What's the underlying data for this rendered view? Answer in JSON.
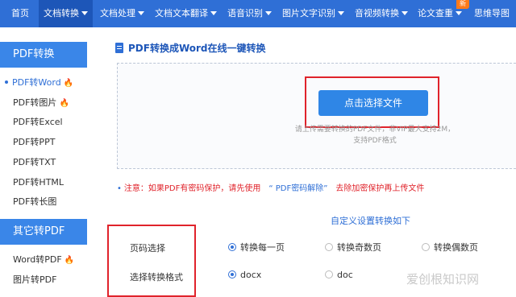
{
  "colors": {
    "nav_bg": "#2f6fd6",
    "accent": "#2f6fd6",
    "highlight_frame": "#e0232b",
    "hot_icon": "#ff6a1a"
  },
  "topnav": {
    "items": [
      {
        "label": "首页",
        "dropdown": false,
        "active": false
      },
      {
        "label": "文档转换",
        "dropdown": true,
        "active": true
      },
      {
        "label": "文档处理",
        "dropdown": true,
        "active": false
      },
      {
        "label": "文档文本翻译",
        "dropdown": true,
        "active": false
      },
      {
        "label": "语音识别",
        "dropdown": true,
        "active": false
      },
      {
        "label": "图片文字识别",
        "dropdown": true,
        "active": false
      },
      {
        "label": "音视频转换",
        "dropdown": true,
        "active": false
      },
      {
        "label": "论文查重",
        "dropdown": true,
        "active": false
      },
      {
        "label": "思维导图",
        "dropdown": false,
        "active": false
      }
    ],
    "new_badge": "新"
  },
  "sidebar": {
    "group1_title": "PDF转换",
    "group1_items": [
      {
        "label": "PDF转Word",
        "hot": true,
        "active": true
      },
      {
        "label": "PDF转图片",
        "hot": true,
        "active": false
      },
      {
        "label": "PDF转Excel",
        "hot": false,
        "active": false
      },
      {
        "label": "PDF转PPT",
        "hot": false,
        "active": false
      },
      {
        "label": "PDF转TXT",
        "hot": false,
        "active": false
      },
      {
        "label": "PDF转HTML",
        "hot": false,
        "active": false
      },
      {
        "label": "PDF转长图",
        "hot": false,
        "active": false
      }
    ],
    "group2_title": "其它转PDF",
    "group2_items": [
      {
        "label": "Word转PDF",
        "hot": true,
        "active": false
      },
      {
        "label": "图片转PDF",
        "hot": false,
        "active": false
      }
    ]
  },
  "main": {
    "title": "PDF转换成Word在线一键转换",
    "upload_button": "点击选择文件",
    "upload_hint_line1": "请上传需要转换的PDF文件，非VIP最大支持2M，",
    "upload_hint_line2": "支持PDF格式",
    "notice_prefix": "注意：如果PDF有密码保护，请先使用",
    "notice_link": "“ PDF密码解除”",
    "notice_suffix": "去除加密保护再上传文件",
    "settings_title": "自定义设置转换如下",
    "page_select_label": "页码选择",
    "page_options": [
      {
        "label": "转换每一页",
        "checked": true
      },
      {
        "label": "转换奇数页",
        "checked": false
      },
      {
        "label": "转换偶数页",
        "checked": false
      }
    ],
    "format_label": "选择转换格式",
    "format_options": [
      {
        "label": "docx",
        "checked": true
      },
      {
        "label": "doc",
        "checked": false
      }
    ]
  },
  "watermark": "爱创根知识网"
}
